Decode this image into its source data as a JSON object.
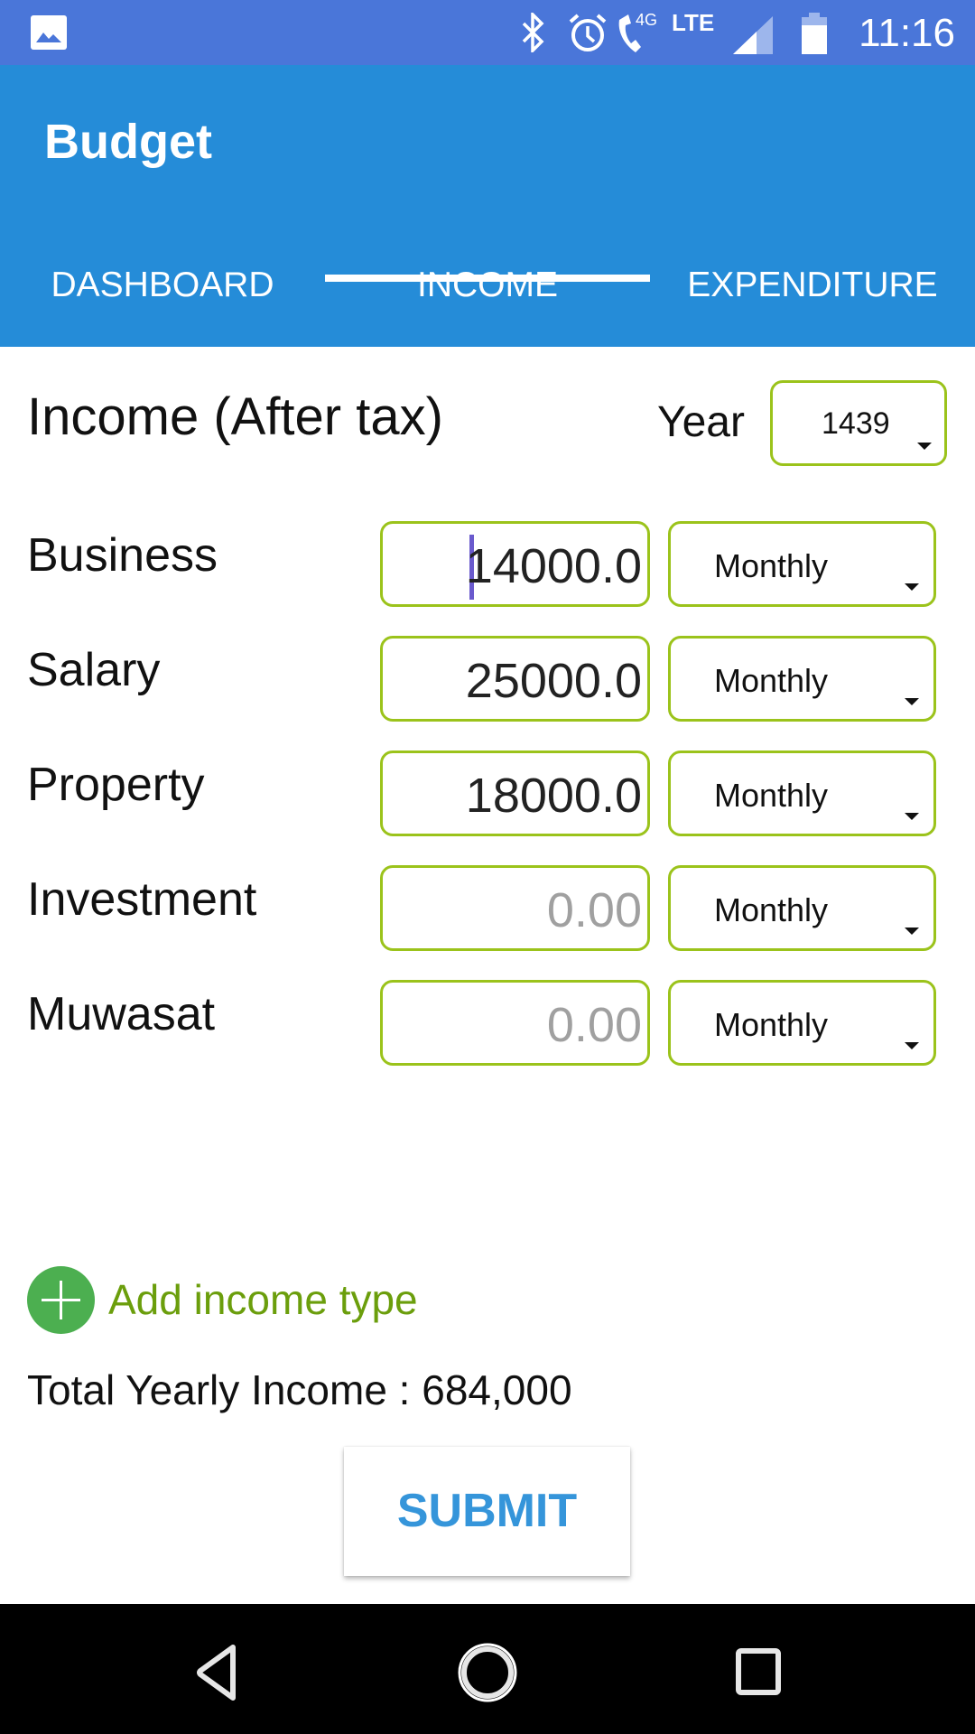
{
  "status_bar": {
    "time": "11:16",
    "network_label": "LTE",
    "call_label": "4G",
    "icons": [
      "gallery-notification-icon",
      "bluetooth-icon",
      "alarm-icon",
      "wifi-calling-icon",
      "signal-icon",
      "battery-icon"
    ]
  },
  "app_bar": {
    "title": "Budget",
    "tabs": [
      {
        "label": "DASHBOARD",
        "selected": false
      },
      {
        "label": "INCOME",
        "selected": true
      },
      {
        "label": "EXPENDITURE",
        "selected": false
      }
    ]
  },
  "income": {
    "title": "Income (After tax)",
    "year_label": "Year",
    "year_value": "1439",
    "rows": [
      {
        "label": "Business",
        "value": "14000.0",
        "placeholder": "0.00",
        "frequency": "Monthly",
        "focused": true
      },
      {
        "label": "Salary",
        "value": "25000.0",
        "placeholder": "0.00",
        "frequency": "Monthly"
      },
      {
        "label": "Property",
        "value": "18000.0",
        "placeholder": "0.00",
        "frequency": "Monthly"
      },
      {
        "label": "Investment",
        "value": "",
        "placeholder": "0.00",
        "frequency": "Monthly"
      },
      {
        "label": "Muwasat",
        "value": "",
        "placeholder": "0.00",
        "frequency": "Monthly"
      }
    ],
    "add_income_label": "Add income type",
    "total_label": "Total Yearly Income : 684,000",
    "submit_label": "SUBMIT"
  },
  "colors": {
    "status_bar": "#4A76D9",
    "app_bar": "#258CD8",
    "field_border": "#9BC31B",
    "add_icon": "#4CAF50",
    "add_text": "#6B9E0C",
    "submit_text": "#3595DA"
  },
  "nav_bar": {
    "buttons": [
      "back",
      "home",
      "recents"
    ]
  }
}
